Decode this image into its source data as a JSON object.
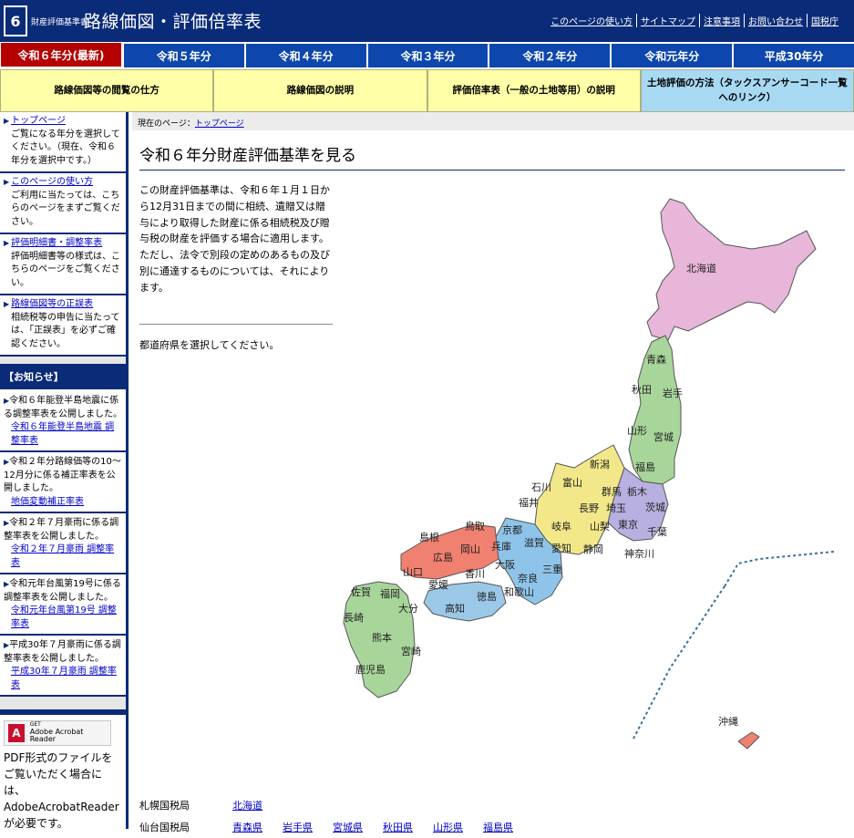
{
  "header": {
    "logo_number": "6",
    "small_title": "財産評価基準書",
    "title": "路線価図・評価倍率表",
    "links": [
      "このページの使い方",
      "サイトマップ",
      "注意事項",
      "お問い合わせ",
      "国税庁"
    ]
  },
  "year_tabs": [
    "令和６年分(最新)",
    "令和５年分",
    "令和４年分",
    "令和３年分",
    "令和２年分",
    "令和元年分",
    "平成30年分"
  ],
  "guide": [
    "路線価図等の閲覧の仕方",
    "路線価図の説明",
    "評価倍率表（一般の土地等用）の説明",
    "土地評価の方法（タックスアンサーコード一覧へのリンク）"
  ],
  "sidebar": {
    "links": [
      {
        "label": "トップページ",
        "desc": "ご覧になる年分を選択してください。（現在、令和６年分を選択中です。）"
      },
      {
        "label": "このページの使い方",
        "desc": "ご利用に当たっては、こちらのページをまずご覧ください。"
      },
      {
        "label": "評価明細書・調整率表",
        "desc": "評価明細書等の様式は、こちらのページをご覧ください。"
      },
      {
        "label": "路線価図等の正誤表",
        "desc": "相続税等の申告に当たっては、「正誤表」を必ずご確認ください。"
      }
    ],
    "news_header": "【お知らせ】",
    "news": [
      {
        "text": "令和６年能登半島地震に係る調整率表を公開しました。",
        "link": "令和６年能登半島地震 調整率表"
      },
      {
        "text": "令和２年分路線価等の10～12月分に係る補正率表を公開しました。",
        "link": "地価変動補正率表"
      },
      {
        "text": "令和２年７月豪雨に係る調整率表を公開しました。",
        "link": "令和２年７月豪雨 調整率表"
      },
      {
        "text": "令和元年台風第19号に係る調整率表を公開しました。",
        "link": "令和元年台風第19号 調整率表"
      },
      {
        "text": "平成30年７月豪雨に係る調整率表を公開しました。",
        "link": "平成30年７月豪雨 調整率表"
      }
    ],
    "pdf": {
      "badge_get": "GET",
      "badge_name": "Adobe Acrobat Reader",
      "text": "PDF形式のファイルをご覧いただく場合には、AdobeAcrobatReaderが必要です。AdobeAcrobatReaderをお持ちでない方は"
    }
  },
  "main": {
    "breadcrumb_label": "現在のページ：",
    "breadcrumb_link": "トップページ",
    "title": "令和６年分財産評価基準を見る",
    "intro": "この財産評価基準は、令和６年１月１日から12月31日までの間に相続、遺贈又は贈与により取得した財産に係る相続税及び贈与税の財産を評価する場合に適用します。ただし、法令で別段の定めのあるもの及び別に通達するものについては、それによります。",
    "choose": "都道府県を選択してください。"
  },
  "colors": {
    "header": "#0a2b78",
    "active_tab": "#b40000",
    "tab": "#0d47ad",
    "guide": "#ffffa8",
    "guide_blue": "#a7d9f2",
    "hokkaido": "#e8b6d8",
    "tohoku": "#a8d59a",
    "kanto": "#b8b0e0",
    "chubu": "#f2e88a",
    "kinki": "#8fc4ea",
    "chugoku": "#f08070",
    "shikoku": "#9cc8e8",
    "kyushu": "#a8d59a"
  },
  "map_labels": {
    "hokkaido": "北海道",
    "aomori": "青森",
    "akita": "秋田",
    "iwate": "岩手",
    "yamagata": "山形",
    "miyagi": "宮城",
    "niigata": "新潟",
    "fukushima": "福島",
    "gunma": "群馬",
    "tochigi": "栃木",
    "ibaraki": "茨城",
    "saitama": "埼玉",
    "chiba": "千葉",
    "tokyo": "東京",
    "kanagawa": "神奈川",
    "nagano": "長野",
    "yamanashi": "山梨",
    "toyama": "富山",
    "ishikawa": "石川",
    "fukui": "福井",
    "gifu": "岐阜",
    "shizuoka": "静岡",
    "aichi": "愛知",
    "mie": "三重",
    "shiga": "滋賀",
    "kyoto": "京都",
    "osaka": "大阪",
    "hyogo": "兵庫",
    "nara": "奈良",
    "wakayama": "和歌山",
    "tottori": "鳥取",
    "shimane": "島根",
    "okayama": "岡山",
    "hiroshima": "広島",
    "yamaguchi": "山口",
    "kagawa": "香川",
    "tokushima": "徳島",
    "ehime": "愛媛",
    "kochi": "高知",
    "fukuoka": "福岡",
    "saga": "佐賀",
    "nagasaki": "長崎",
    "kumamoto": "熊本",
    "oita": "大分",
    "miyazaki": "宮崎",
    "kagoshima": "鹿児島",
    "okinawa": "沖縄"
  },
  "bureaus": [
    {
      "name": "札幌国税局",
      "prefs": [
        "北海道"
      ]
    },
    {
      "name": "仙台国税局",
      "prefs": [
        "青森県",
        "岩手県",
        "宮城県",
        "秋田県",
        "山形県",
        "福島県"
      ]
    }
  ]
}
